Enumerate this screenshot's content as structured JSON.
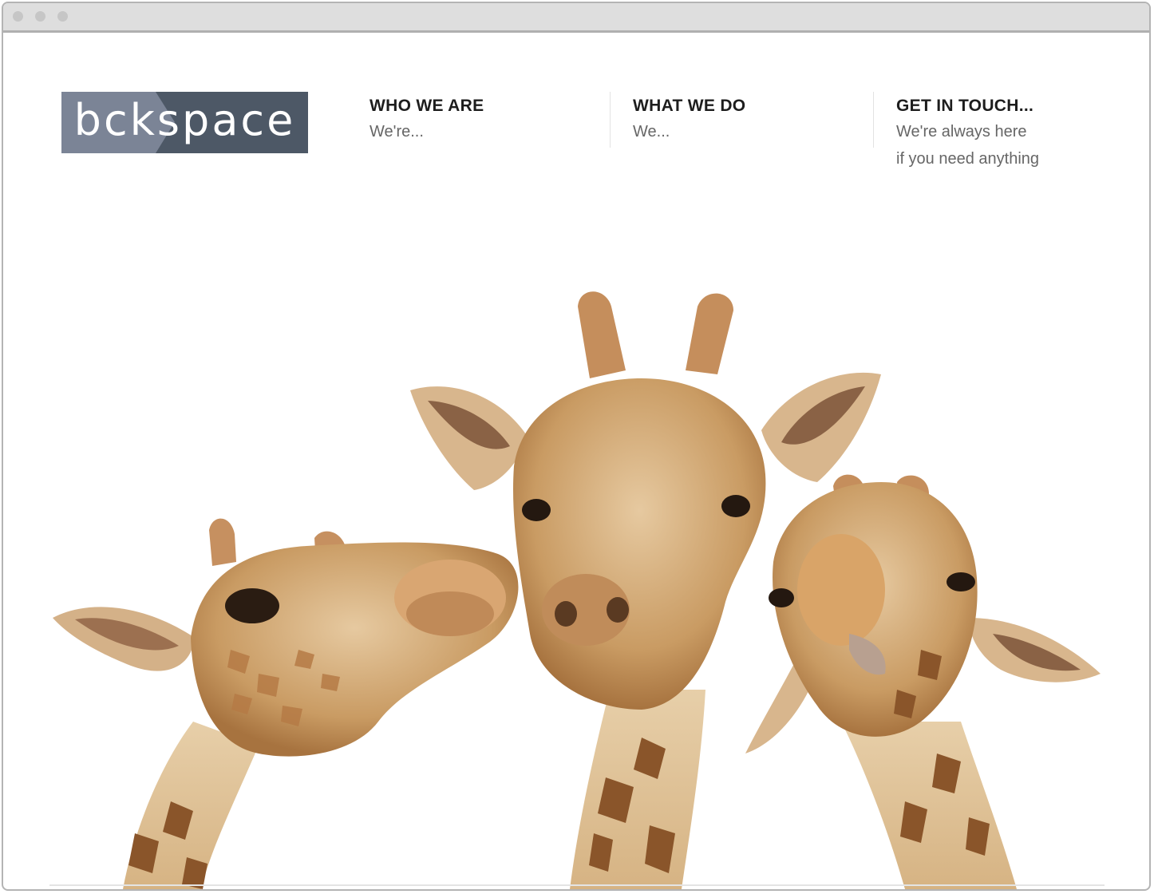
{
  "logo": {
    "text": "bckspace"
  },
  "nav": [
    {
      "title": "WHO WE ARE",
      "line1": "We're...",
      "line2": ""
    },
    {
      "title": "WHAT WE DO",
      "line1": "We...",
      "line2": ""
    },
    {
      "title": "GET IN TOUCH...",
      "line1": "We're always here",
      "line2": "if you need anything"
    }
  ],
  "colors": {
    "logo_light": "#7b8496",
    "logo_dark": "#4d5866",
    "accent_text": "#1d1d1d",
    "body_text": "#666666"
  },
  "hero": {
    "icons": [
      "giraffe-left-icon",
      "giraffe-center-icon",
      "giraffe-right-icon"
    ]
  }
}
